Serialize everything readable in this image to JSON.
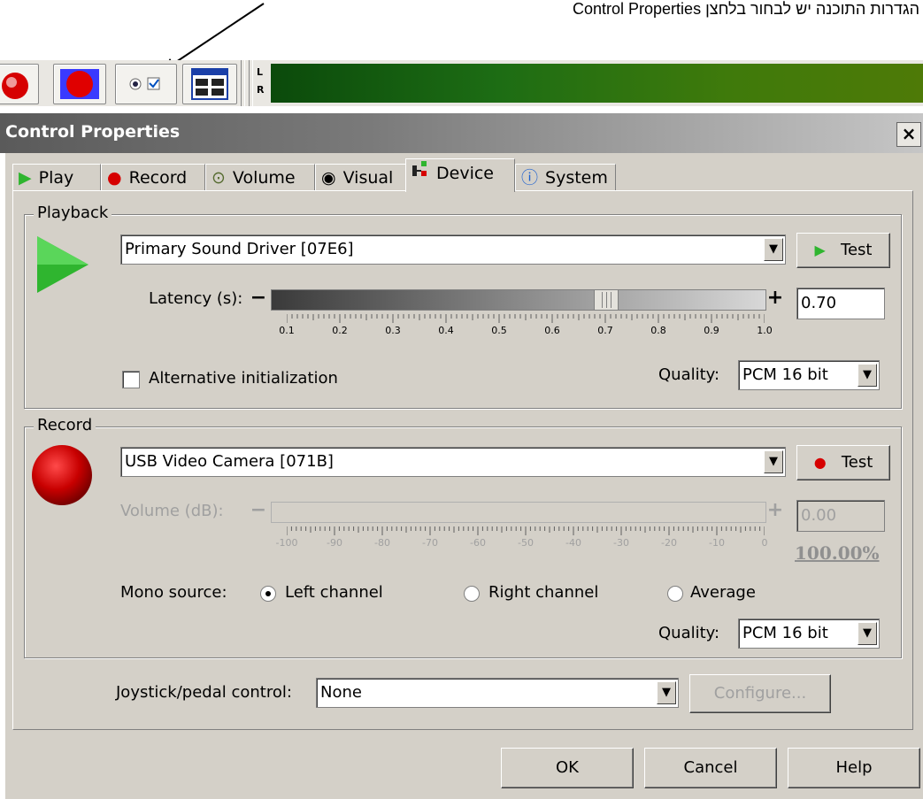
{
  "annotation": "הגדרות התוכנה יש לבחור בלחצן Control Properties",
  "meter": {
    "left_label": "L",
    "right_label": "R"
  },
  "window": {
    "title": "Control Properties",
    "close": "×"
  },
  "tabs": [
    {
      "label": "Play",
      "icon": "play-icon"
    },
    {
      "label": "Record",
      "icon": "record-icon"
    },
    {
      "label": "Volume",
      "icon": "volume-icon"
    },
    {
      "label": "Visual",
      "icon": "eye-icon"
    },
    {
      "label": "Device",
      "icon": "device-icon",
      "active": true
    },
    {
      "label": "System",
      "icon": "system-info-icon"
    }
  ],
  "playback": {
    "group_label": "Playback",
    "device": "Primary Sound Driver [07E6]",
    "test_label": "Test",
    "latency_label": "Latency (s):",
    "latency_value": "0.70",
    "latency_min": 0.1,
    "latency_max": 1.0,
    "latency_ticks": [
      "0.1",
      "0.2",
      "0.3",
      "0.4",
      "0.5",
      "0.6",
      "0.7",
      "0.8",
      "0.9",
      "1.0"
    ],
    "alt_init_label": "Alternative initialization",
    "alt_init_checked": false,
    "quality_label": "Quality:",
    "quality_value": "PCM 16 bit"
  },
  "record": {
    "group_label": "Record",
    "device": "USB Video Camera [071B]",
    "test_label": "Test",
    "volume_label": "Volume (dB):",
    "volume_value": "0.00",
    "volume_percent": "100.00%",
    "volume_ticks": [
      "-100",
      "-90",
      "-80",
      "-70",
      "-60",
      "-50",
      "-40",
      "-30",
      "-20",
      "-10",
      "0"
    ],
    "mono_label": "Mono source:",
    "mono_options": [
      "Left channel",
      "Right channel",
      "Average"
    ],
    "mono_selected": "Left channel",
    "quality_label": "Quality:",
    "quality_value": "PCM 16 bit"
  },
  "joystick": {
    "label": "Joystick/pedal control:",
    "value": "None",
    "configure_label": "Configure..."
  },
  "footer": {
    "ok": "OK",
    "cancel": "Cancel",
    "help": "Help"
  },
  "colors": {
    "play_green": "#2fb52f",
    "record_red": "#d60000",
    "disabled_gray": "#a0a0a0"
  }
}
